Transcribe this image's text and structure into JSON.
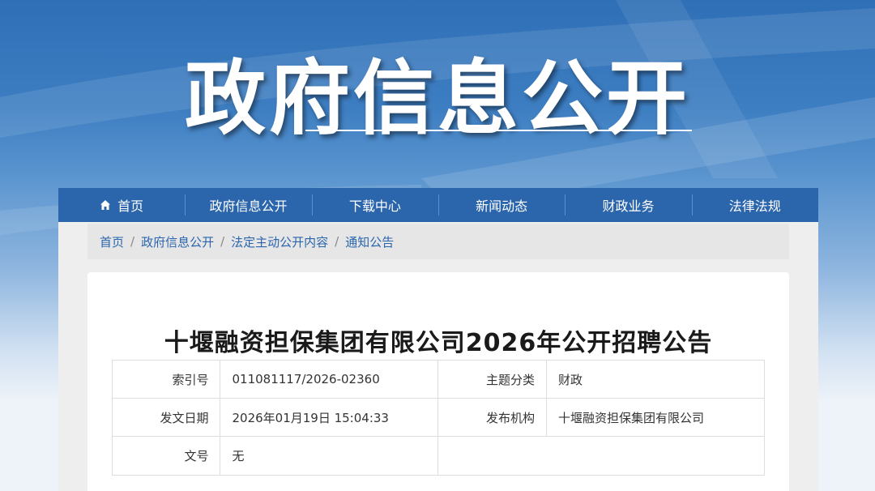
{
  "banner": {
    "title": "政府信息公开"
  },
  "nav": {
    "items": [
      {
        "label": "首页",
        "icon": "home-icon"
      },
      {
        "label": "政府信息公开"
      },
      {
        "label": "下载中心"
      },
      {
        "label": "新闻动态"
      },
      {
        "label": "财政业务"
      },
      {
        "label": "法律法规"
      }
    ]
  },
  "breadcrumb": {
    "items": [
      "首页",
      "政府信息公开",
      "法定主动公开内容",
      "通知公告"
    ],
    "separator": "/"
  },
  "article": {
    "title": "十堰融资担保集团有限公司2026年公开招聘公告",
    "meta": {
      "index_label": "索引号",
      "index_value": "011081117/2026-02360",
      "topic_label": "主题分类",
      "topic_value": "财政",
      "date_label": "发文日期",
      "date_value": "2026年01月19日 15:04:33",
      "org_label": "发布机构",
      "org_value": "十堰融资担保集团有限公司",
      "docno_label": "文号",
      "docno_value": "无"
    }
  },
  "colors": {
    "nav_bg": "#2b66ad",
    "link": "#2b66ad",
    "banner_top": "#2f6fb6"
  }
}
